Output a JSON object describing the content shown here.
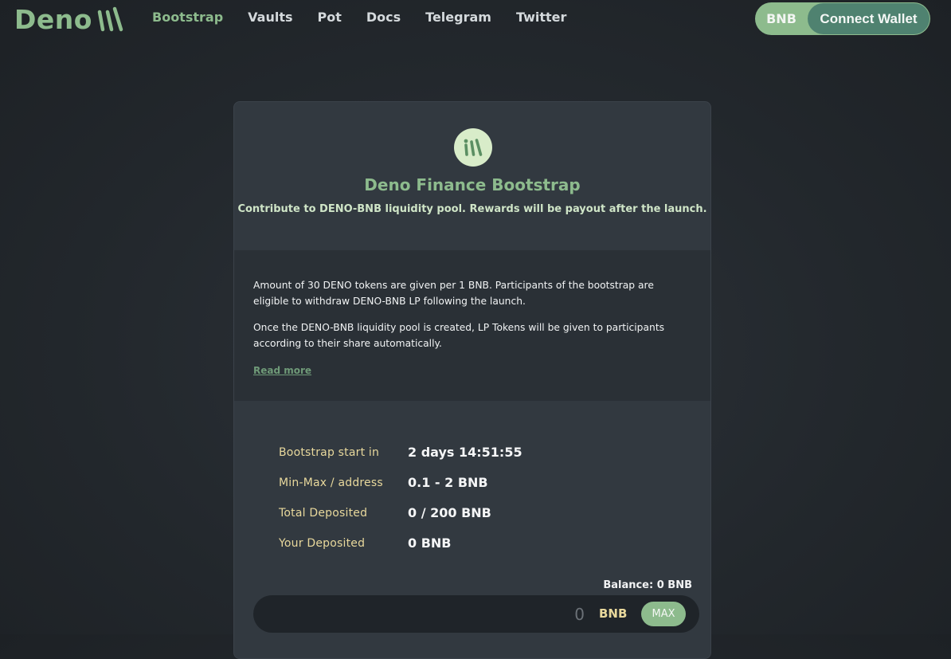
{
  "nav": {
    "logo_text": "Deno",
    "links": [
      {
        "label": "Bootstrap"
      },
      {
        "label": "Vaults"
      },
      {
        "label": "Pot"
      },
      {
        "label": "Docs"
      },
      {
        "label": "Telegram"
      },
      {
        "label": "Twitter"
      }
    ],
    "active_index": 0,
    "wallet_chain": "BNB",
    "connect_label": "Connect Wallet"
  },
  "card": {
    "title": "Deno Finance Bootstrap",
    "subtitle": "Contribute to DENO-BNB liquidity pool. Rewards will be payout after the launch.",
    "info_paragraphs": [
      "Amount of 30 DENO tokens are given per 1 BNB. Participants of the bootstrap are eligible to withdraw DENO-BNB LP following the launch.",
      "Once the DENO-BNB liquidity pool is created, LP Tokens will be given to participants according to their share automatically."
    ],
    "read_more": "Read more",
    "stats": [
      {
        "label": "Bootstrap start in",
        "value": "2 days 14:51:55"
      },
      {
        "label": "Min-Max / address",
        "value": "0.1 - 2 BNB"
      },
      {
        "label": "Total Deposited",
        "value": "0 / 200 BNB"
      },
      {
        "label": "Your Deposited",
        "value": "0 BNB"
      }
    ],
    "balance": "Balance: 0 BNB",
    "amount_placeholder": "0",
    "amount_unit": "BNB",
    "max_label": "MAX"
  },
  "colors": {
    "accent": "#8dbb8d",
    "wallet_button": "#4f8270",
    "label_yellow": "#e8d89c",
    "background": "#23282d",
    "card": "#323940"
  }
}
